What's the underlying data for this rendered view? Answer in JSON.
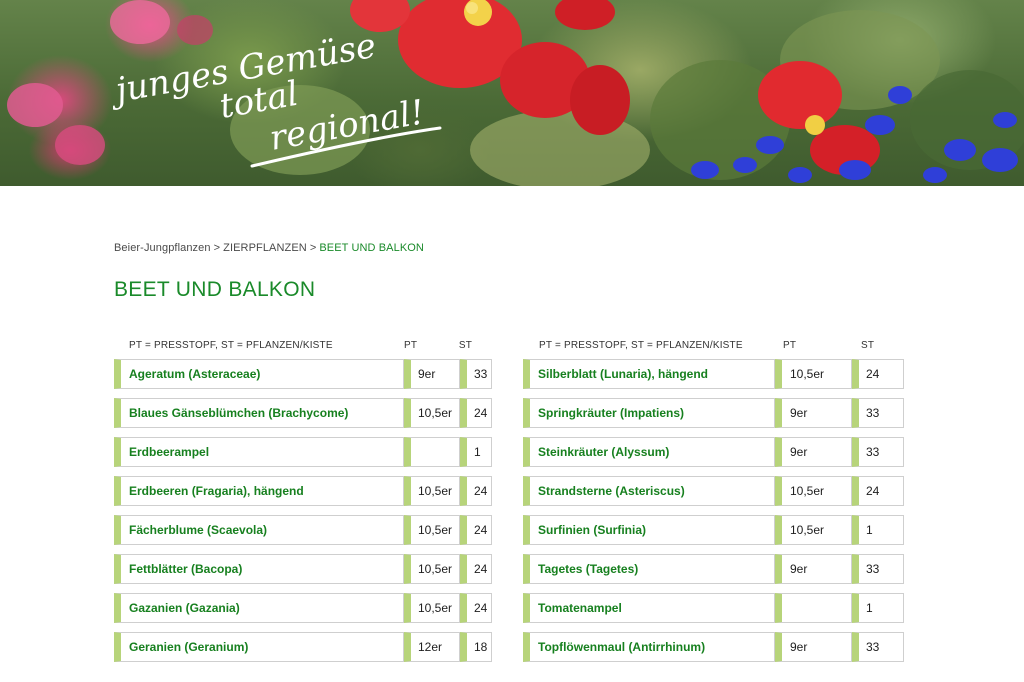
{
  "hero": {
    "slogan_line1": "junges Gemüse",
    "slogan_line2": "total",
    "slogan_line3": "regional!"
  },
  "breadcrumb": {
    "items": [
      "Beier-Jungpflanzen",
      "ZIERPFLANZEN"
    ],
    "separator": ">",
    "current": "BEET UND BALKON"
  },
  "page": {
    "title": "BEET UND BALKON"
  },
  "tables": {
    "left": {
      "header": {
        "name": "PT = PRESSTOPF, ST = PFLANZEN/KISTE",
        "pt": "PT",
        "st": "ST"
      },
      "rows": [
        {
          "name": "Ageratum (Asteraceae)",
          "pt": "9er",
          "st": "33"
        },
        {
          "name": "Blaues Gänseblümchen (Brachycome)",
          "pt": "10,5er",
          "st": "24"
        },
        {
          "name": "Erdbeerampel",
          "pt": "",
          "st": "1"
        },
        {
          "name": "Erdbeeren (Fragaria), hängend",
          "pt": "10,5er",
          "st": "24"
        },
        {
          "name": "Fächerblume (Scaevola)",
          "pt": "10,5er",
          "st": "24"
        },
        {
          "name": "Fettblätter (Bacopa)",
          "pt": "10,5er",
          "st": "24"
        },
        {
          "name": "Gazanien (Gazania)",
          "pt": "10,5er",
          "st": "24"
        },
        {
          "name": "Geranien (Geranium)",
          "pt": "12er",
          "st": "18"
        }
      ]
    },
    "right": {
      "header": {
        "name": "PT = PRESSTOPF, ST = PFLANZEN/KISTE",
        "pt": "PT",
        "st": "ST"
      },
      "rows": [
        {
          "name": "Silberblatt (Lunaria), hängend",
          "pt": "10,5er",
          "st": "24"
        },
        {
          "name": "Springkräuter (Impatiens)",
          "pt": "9er",
          "st": "33"
        },
        {
          "name": "Steinkräuter (Alyssum)",
          "pt": "9er",
          "st": "33"
        },
        {
          "name": "Strandsterne (Asteriscus)",
          "pt": "10,5er",
          "st": "24"
        },
        {
          "name": "Surfinien (Surfinia)",
          "pt": "10,5er",
          "st": "1"
        },
        {
          "name": "Tagetes (Tagetes)",
          "pt": "9er",
          "st": "33"
        },
        {
          "name": "Tomatenampel",
          "pt": "",
          "st": "1"
        },
        {
          "name": "Topflöwenmaul (Antirrhinum)",
          "pt": "9er",
          "st": "33"
        }
      ]
    }
  },
  "colors": {
    "accent_green": "#1a8a2a",
    "row_marker": "#b7d47a",
    "border": "#cfcfcf"
  }
}
